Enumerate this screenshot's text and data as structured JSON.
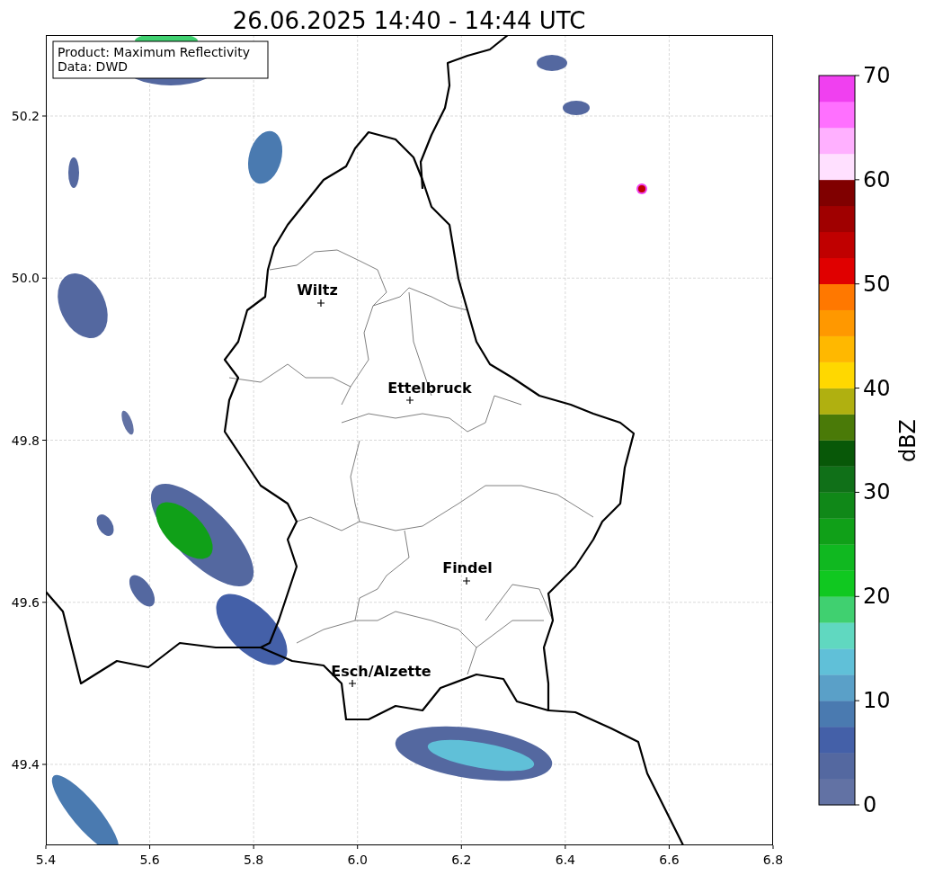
{
  "title": "26.06.2025 14:40 - 14:44 UTC",
  "info_box": {
    "lines": [
      "Product: Maximum Reflectivity",
      "Data: DWD"
    ]
  },
  "cities": [
    "Wiltz",
    "Ettelbruck",
    "Findel",
    "Esch/Alzette"
  ],
  "x_axis": {
    "ticks": [
      "5.4",
      "5.6",
      "5.8",
      "6.0",
      "6.2",
      "6.4",
      "6.6",
      "6.8"
    ]
  },
  "y_axis": {
    "ticks": [
      "50.2",
      "50.0",
      "49.8",
      "49.6",
      "49.4"
    ]
  },
  "colorbar": {
    "label": "dBZ",
    "ticks": [
      "70",
      "60",
      "50",
      "40",
      "30",
      "20",
      "10",
      "0"
    ],
    "segments": [
      {
        "color": "#6272a4"
      },
      {
        "color": "#5468a0"
      },
      {
        "color": "#4460a8"
      },
      {
        "color": "#4a7ab0"
      },
      {
        "color": "#5aa0c8"
      },
      {
        "color": "#60c0d8"
      },
      {
        "color": "#60d8c0"
      },
      {
        "color": "#40d070"
      },
      {
        "color": "#10c820"
      },
      {
        "color": "#10b820"
      },
      {
        "color": "#10a018"
      },
      {
        "color": "#108818"
      },
      {
        "color": "#107018"
      },
      {
        "color": "#085808"
      },
      {
        "color": "#4a7a08"
      },
      {
        "color": "#b0b010"
      },
      {
        "color": "#ffd800"
      },
      {
        "color": "#ffb800"
      },
      {
        "color": "#ff9800"
      },
      {
        "color": "#ff7800"
      },
      {
        "color": "#e00000"
      },
      {
        "color": "#c00000"
      },
      {
        "color": "#a00000"
      },
      {
        "color": "#800000"
      },
      {
        "color": "#ffe0ff"
      },
      {
        "color": "#ffb0ff"
      },
      {
        "color": "#ff70ff"
      },
      {
        "color": "#f040f0"
      }
    ]
  }
}
